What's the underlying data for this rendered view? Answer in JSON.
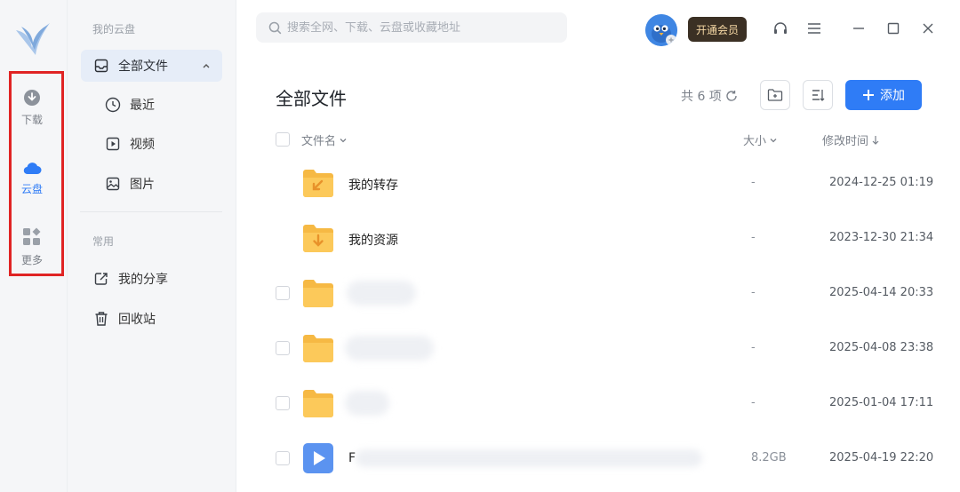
{
  "rail": {
    "items": [
      {
        "label": "下载",
        "icon": "download-icon"
      },
      {
        "label": "云盘",
        "icon": "cloud-icon"
      },
      {
        "label": "更多",
        "icon": "grid-icon"
      }
    ],
    "active_index": 1,
    "highlight_color": "#e02424",
    "accent": "#2f7cf6"
  },
  "sidebar": {
    "section_mine": "我的云盘",
    "all_files": "全部文件",
    "recent": "最近",
    "video": "视频",
    "pictures": "图片",
    "section_common": "常用",
    "my_share": "我的分享",
    "recycle_bin": "回收站"
  },
  "topbar": {
    "search_placeholder": "搜索全网、下载、云盘或收藏地址",
    "vip_label": "开通会员",
    "vip_bg": "#3b3024",
    "vip_fg": "#f7d9a6"
  },
  "main": {
    "title": "全部文件",
    "count": "共 6 项",
    "add_label": "添加",
    "columns": {
      "name": "文件名",
      "size": "大小",
      "modified": "修改时间"
    },
    "rows": [
      {
        "name": "我的转存",
        "size": "-",
        "time": "2024-12-25 01:19",
        "kind": "special-folder-transfer"
      },
      {
        "name": "我的资源",
        "size": "-",
        "time": "2023-12-30 21:34",
        "kind": "special-folder-resource"
      },
      {
        "name": "",
        "size": "-",
        "time": "2025-04-14 20:33",
        "kind": "folder"
      },
      {
        "name": "",
        "size": "-",
        "time": "2025-04-08 23:38",
        "kind": "folder"
      },
      {
        "name": "",
        "size": "-",
        "time": "2025-01-04 17:11",
        "kind": "folder"
      },
      {
        "name": "F",
        "size": "8.2GB",
        "time": "2025-04-19 22:20",
        "kind": "video"
      }
    ]
  }
}
